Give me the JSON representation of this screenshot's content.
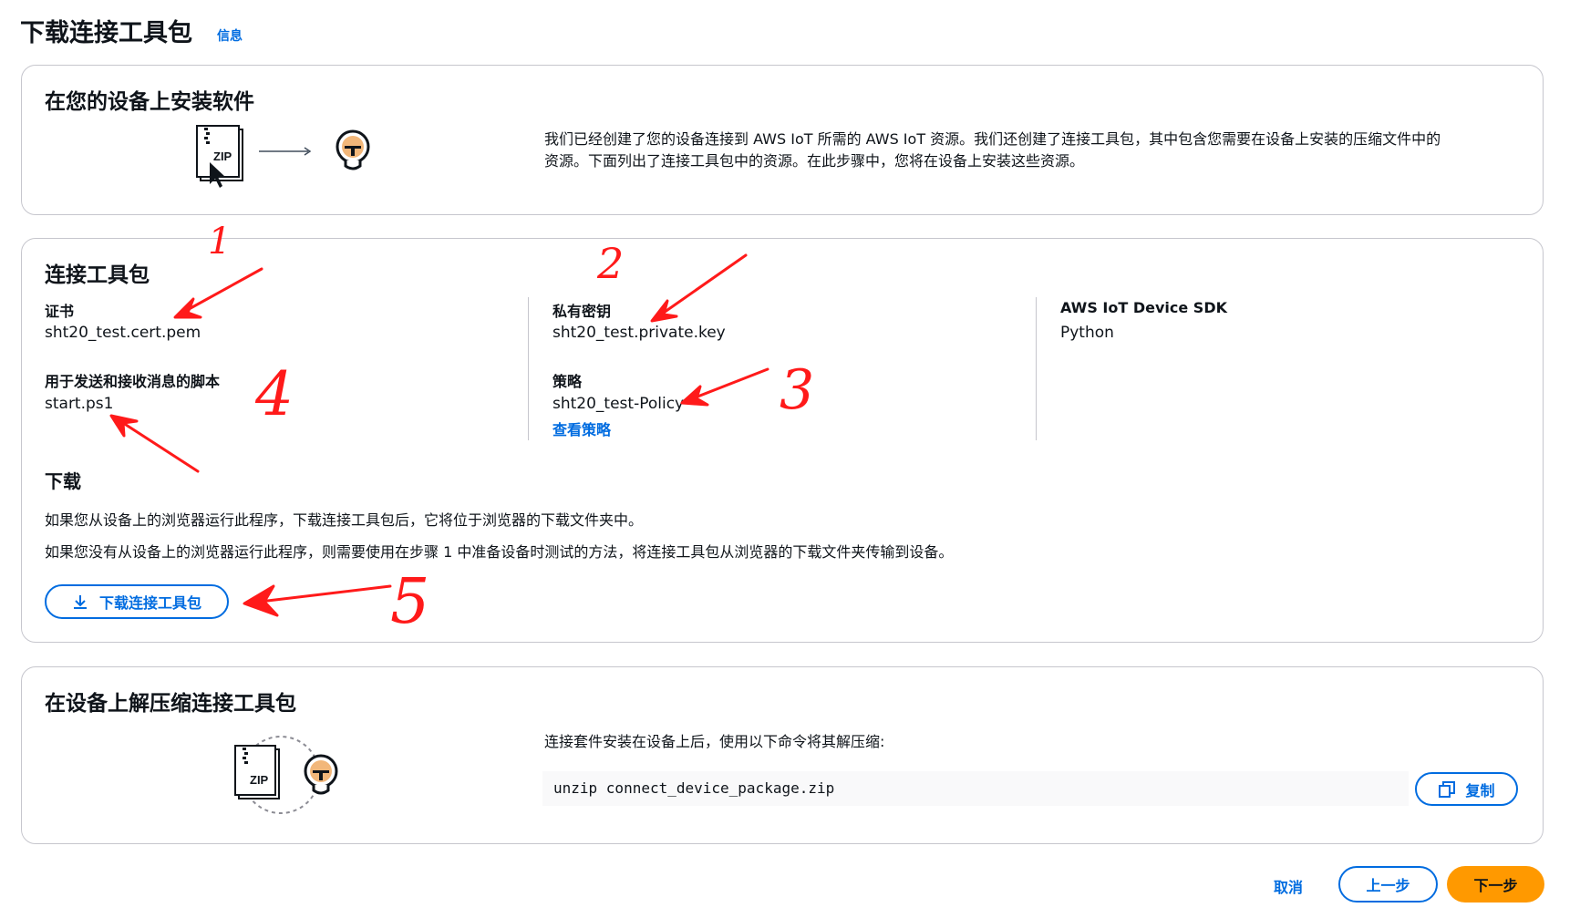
{
  "header": {
    "title": "下载连接工具包",
    "info_link": "信息"
  },
  "install_card": {
    "title": "在您的设备上安装软件",
    "zip_label": "ZIP",
    "description_line1": "我们已经创建了您的设备连接到 AWS IoT 所需的 AWS IoT 资源。我们还创建了连接工具包，其中包含您需要在设备上安装的压缩文件中的",
    "description_line2": "资源。下面列出了连接工具包中的资源。在此步骤中，您将在设备上安装这些资源。"
  },
  "kit_card": {
    "title": "连接工具包",
    "certificate": {
      "label": "证书",
      "value": "sht20_test.cert.pem"
    },
    "script": {
      "label": "用于发送和接收消息的脚本",
      "value": "start.ps1"
    },
    "private_key": {
      "label": "私有密钥",
      "value": "sht20_test.private.key"
    },
    "policy": {
      "label": "策略",
      "value": "sht20_test-Policy",
      "link": "查看策略"
    },
    "sdk": {
      "label": "AWS IoT Device SDK",
      "value": "Python"
    },
    "download": {
      "title": "下载",
      "line1": "如果您从设备上的浏览器运行此程序，下载连接工具包后，它将位于浏览器的下载文件夹中。",
      "line2": "如果您没有从设备上的浏览器运行此程序，则需要使用在步骤 1 中准备设备时测试的方法，将连接工具包从浏览器的下载文件夹传输到设备。",
      "button": "下载连接工具包"
    }
  },
  "unzip_card": {
    "title": "在设备上解压缩连接工具包",
    "zip_label": "ZIP",
    "instruction": "连接套件安装在设备上后，使用以下命令将其解压缩:",
    "command": "unzip connect_device_package.zip",
    "copy_button": "复制"
  },
  "footer": {
    "cancel": "取消",
    "previous": "上一步",
    "next": "下一步"
  },
  "annotations": {
    "n1": "1",
    "n2": "2",
    "n3": "3",
    "n4": "4",
    "n5": "5",
    "color": "#ff1a1a"
  },
  "colors": {
    "accent": "#006ce0",
    "primary_button": "#ff9900",
    "border": "#c6c6cd"
  }
}
